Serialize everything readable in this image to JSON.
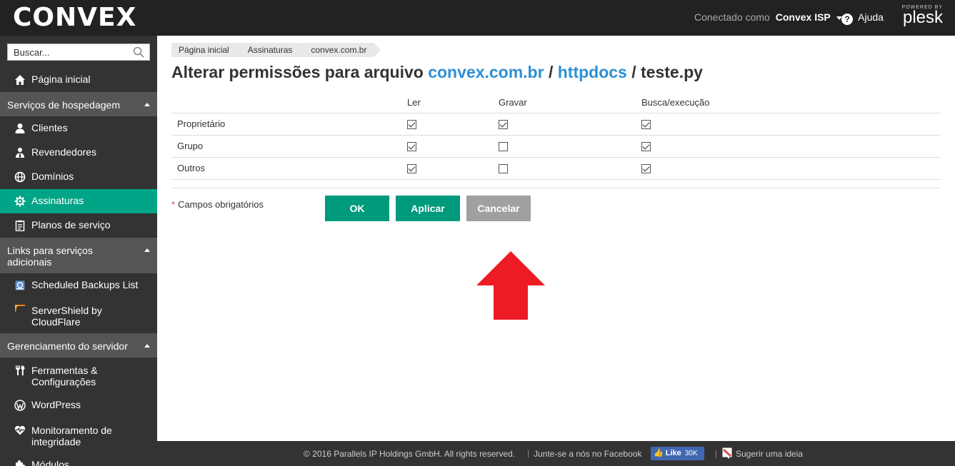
{
  "header": {
    "logo": "CONVEX",
    "connected_label": "Conectado como",
    "user": "Convex ISP",
    "help": "Ajuda",
    "powered_by": "POWERED BY",
    "plesk": "plesk"
  },
  "sidebar": {
    "search_placeholder": "Buscar...",
    "home": "Página inicial",
    "section_hosting": "Serviços de hospedagem",
    "clients": "Clientes",
    "resellers": "Revendedores",
    "domains": "Domínios",
    "subscriptions": "Assinaturas",
    "service_plans": "Planos de serviço",
    "section_links": "Links para serviços adicionais",
    "scheduled_backups": "Scheduled Backups List",
    "servershield": "ServerShield by CloudFlare",
    "section_server": "Gerenciamento do servidor",
    "tools": "Ferramentas & Configurações",
    "wordpress": "WordPress",
    "monitoring": "Monitoramento de integridade",
    "modules": "Módulos"
  },
  "breadcrumb": [
    "Página inicial",
    "Assinaturas",
    "convex.com.br"
  ],
  "title": {
    "prefix": "Alterar permissões para arquivo",
    "link1": "convex.com.br",
    "sep1": "/",
    "link2": "httpdocs",
    "sep2": "/",
    "file": "teste.py"
  },
  "permissions": {
    "columns": [
      "Ler",
      "Gravar",
      "Busca/execução"
    ],
    "rows": [
      {
        "label": "Proprietário",
        "values": [
          true,
          true,
          true
        ]
      },
      {
        "label": "Grupo",
        "values": [
          true,
          false,
          true
        ]
      },
      {
        "label": "Outros",
        "values": [
          true,
          false,
          true
        ]
      }
    ]
  },
  "form": {
    "required_star": "*",
    "required_label": "Campos obrigatórios",
    "ok": "OK",
    "apply": "Aplicar",
    "cancel": "Cancelar"
  },
  "footer": {
    "copyright": "© 2016 Parallels IP Holdings GmbH. All rights reserved.",
    "facebook": "Junte-se a nós no Facebook",
    "like": "Like",
    "like_count": "30K",
    "idea": "Sugerir uma ideia"
  },
  "colors": {
    "accent": "#00a486",
    "link": "#2d8fd5",
    "arrow": "#ed1c24"
  }
}
